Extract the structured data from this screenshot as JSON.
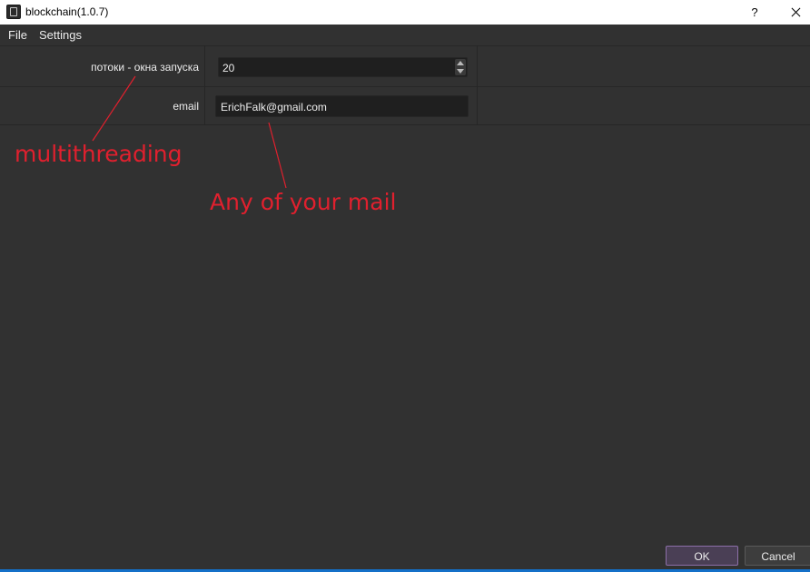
{
  "window": {
    "title": "blockchain(1.0.7)",
    "help_label": "?",
    "icon": "app-icon"
  },
  "menu": {
    "items": [
      {
        "label": "File"
      },
      {
        "label": "Settings"
      }
    ]
  },
  "form": {
    "threads": {
      "label": "потоки - окна запуска",
      "value": "20"
    },
    "email": {
      "label": "email",
      "value": "ErichFalk@gmail.com"
    }
  },
  "annotations": {
    "multithreading": "multithreading",
    "mail": "Any of your mail",
    "color": "#e0202e"
  },
  "buttons": {
    "ok": "OK",
    "cancel": "Cancel"
  },
  "colors": {
    "background": "#313131",
    "input_background": "#1f1f1f",
    "ok_border": "#8c6fa8"
  }
}
